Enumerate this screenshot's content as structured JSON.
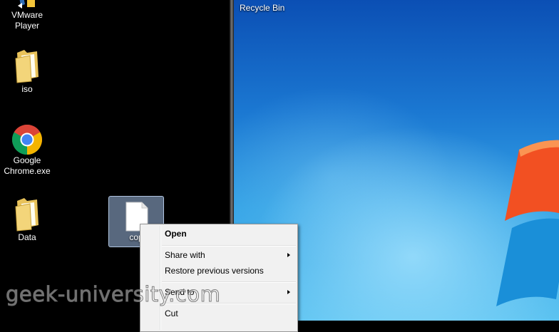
{
  "desktop_left": {
    "icons": [
      {
        "label": "VMware Player",
        "icon": "vmware-player-icon"
      },
      {
        "label": "iso",
        "icon": "folder-icon"
      },
      {
        "label": "Google Chrome.exe",
        "icon": "chrome-icon"
      },
      {
        "label": "Data",
        "icon": "folder-icon"
      }
    ],
    "selected_file": {
      "label": "cop",
      "icon": "file-icon"
    }
  },
  "desktop_right": {
    "recycle_bin_label": "Recycle Bin"
  },
  "context_menu": {
    "items": [
      {
        "label": "Open",
        "bold": true,
        "submenu": false
      },
      {
        "label": "Share with",
        "bold": false,
        "submenu": true
      },
      {
        "label": "Restore previous versions",
        "bold": false,
        "submenu": false
      },
      {
        "label": "Send to",
        "bold": false,
        "submenu": true
      },
      {
        "label": "Cut",
        "bold": false,
        "submenu": false
      }
    ]
  },
  "watermark": "geek-university.com",
  "colors": {
    "menu_bg": "#f1f1f1",
    "desktop_blue": "#1b78d2",
    "selection": "#a0bee6"
  }
}
